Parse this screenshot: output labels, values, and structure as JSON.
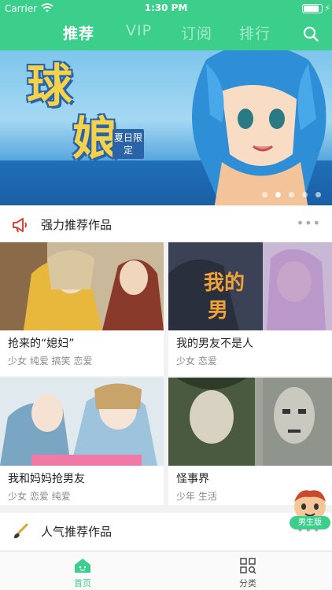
{
  "status_bar": {
    "carrier": "Carrier",
    "time": "1:30 PM"
  },
  "nav": {
    "tabs": [
      {
        "label": "推荐",
        "active": true
      },
      {
        "label": "VIP",
        "active": false
      },
      {
        "label": "订阅",
        "active": false
      },
      {
        "label": "排行",
        "active": false
      }
    ],
    "search_icon": "search-icon"
  },
  "banner": {
    "title_line1": "球",
    "title_line2": "娘",
    "tag": "夏日限定",
    "slide_count": 5,
    "active_slide": 1
  },
  "sections": [
    {
      "title": "强力推荐作品",
      "icon": "megaphone-icon",
      "more": "•••",
      "items": [
        {
          "name": "抢来的“媳妇”",
          "tags": "少女  纯爱  搞笑  恋爱"
        },
        {
          "name": "我的男友不是人",
          "tags": "少女  恋爱"
        },
        {
          "name": "我和妈妈抢男友",
          "tags": "少女  恋爱  纯爱"
        },
        {
          "name": "怪事界",
          "tags": "少年  生活"
        }
      ]
    },
    {
      "title": "人气推荐作品",
      "icon": "brush-icon",
      "more": "•••"
    }
  ],
  "mascot": {
    "label": "男生版"
  },
  "tabbar": [
    {
      "label": "首页",
      "icon": "home-icon",
      "active": true
    },
    {
      "label": "分类",
      "icon": "category-grid-icon",
      "active": false
    }
  ],
  "colors": {
    "brand": "#3ccf8c",
    "text": "#222222",
    "muted": "#8a8a8a"
  }
}
